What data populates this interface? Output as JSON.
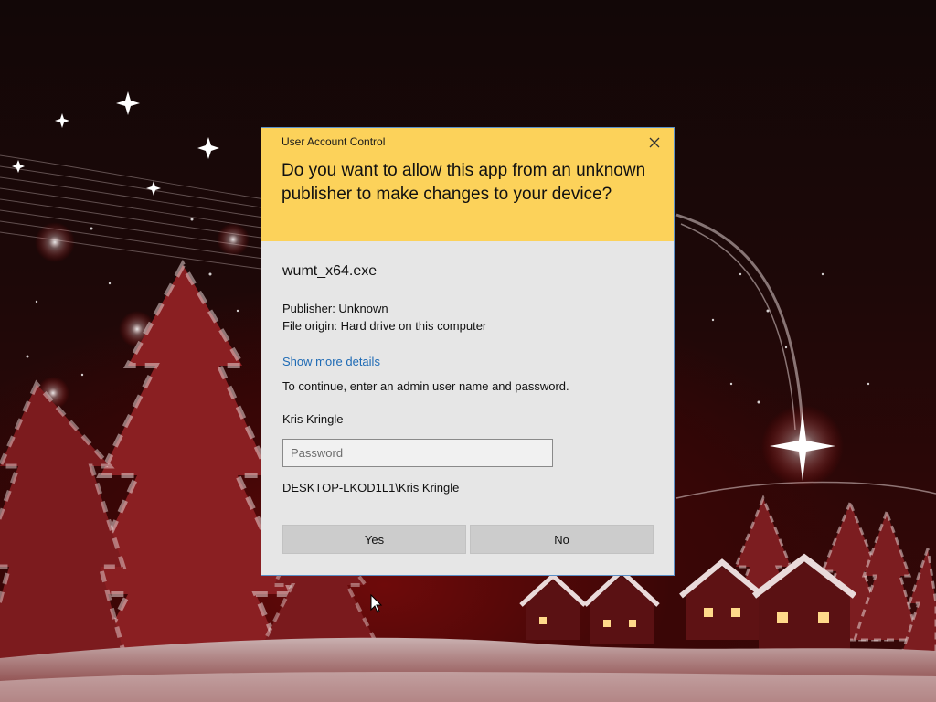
{
  "uac": {
    "title": "User Account Control",
    "question": "Do you want to allow this app from an unknown publisher to make changes to your device?",
    "app_name": "wumt_x64.exe",
    "publisher": "Publisher: Unknown",
    "file_origin": "File origin: Hard drive on this computer",
    "show_details": "Show more details",
    "continue_text": "To continue, enter an admin user name and password.",
    "user_name": "Kris Kringle",
    "password_value": "",
    "password_placeholder": "Password",
    "domain_user": "DESKTOP-LKOD1L1\\Kris Kringle",
    "yes_label": "Yes",
    "no_label": "No",
    "close_icon": "close-icon"
  },
  "colors": {
    "header_bg": "#fcd25a",
    "dialog_bg": "#e6e6e6",
    "link": "#1f6bb5",
    "button_bg": "#cccccc",
    "border_accent": "#5a8fc7"
  },
  "wallpaper": {
    "theme": "christmas-night-village",
    "icons": [
      "star-icon",
      "pine-tree-icon",
      "cottage-icon",
      "snowflake-icon"
    ]
  },
  "cursor": {
    "icon": "arrow-cursor-icon"
  }
}
